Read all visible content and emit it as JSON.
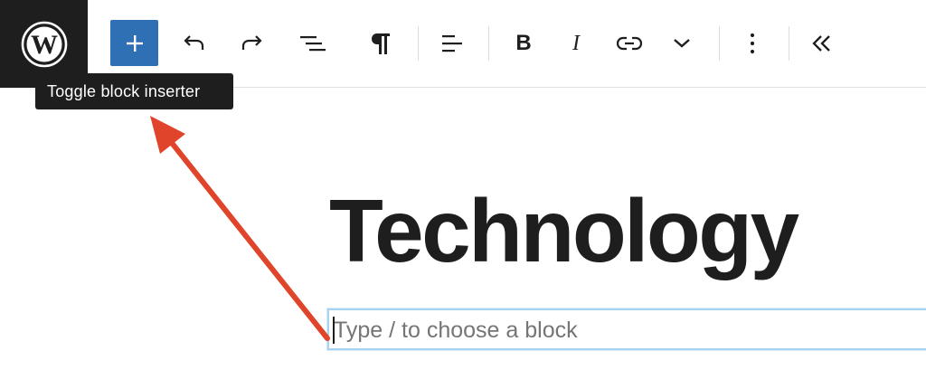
{
  "toolbar": {
    "logo_icon": "wordpress-logo-icon",
    "inserter_icon": "plus-icon",
    "undo_icon": "undo-icon",
    "redo_icon": "redo-icon",
    "list_view_icon": "list-view-icon",
    "paragraph_icon": "paragraph-icon",
    "align_icon": "align-left-icon",
    "bold_label": "B",
    "italic_label": "I",
    "link_icon": "link-icon",
    "more_rich_text_icon": "chevron-down-icon",
    "options_icon": "more-vertical-icon",
    "collapse_icon": "chevrons-left-icon",
    "accent_color": "#2f6fb3"
  },
  "tooltip": {
    "text": "Toggle block inserter"
  },
  "editor": {
    "title": "Technology",
    "block_placeholder": "Type / to choose a block"
  },
  "annotation": {
    "arrow_color": "#e0442a"
  }
}
